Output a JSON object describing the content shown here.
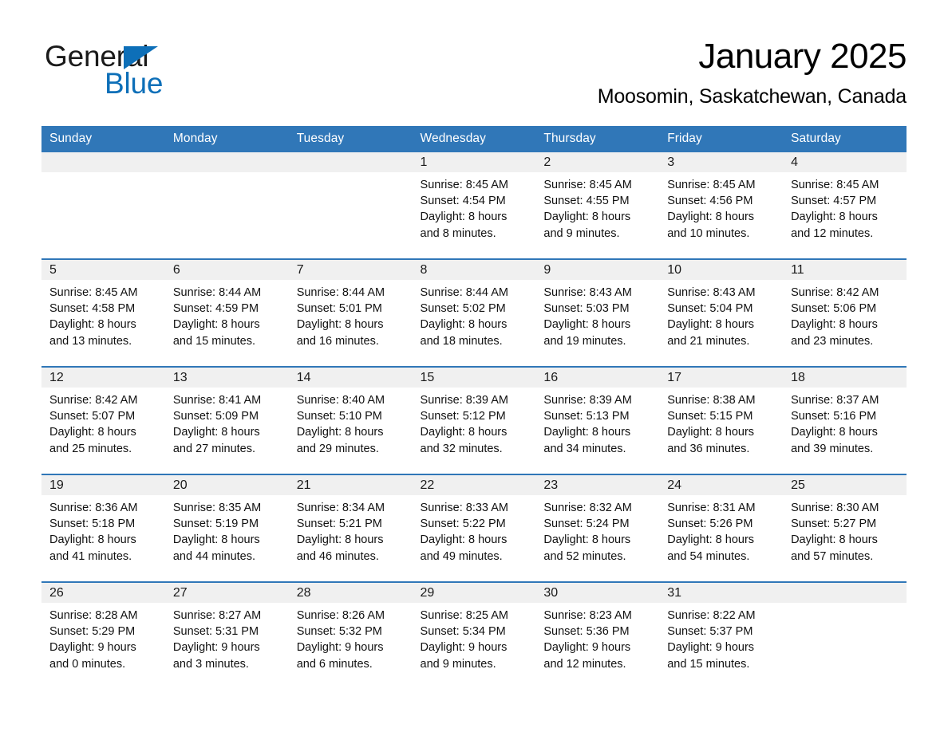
{
  "logo": {
    "word_one": "General",
    "word_two": "Blue",
    "triangle_icon": "triangle-icon",
    "brand_blue": "#0d6fb8"
  },
  "header": {
    "title": "January 2025",
    "location": "Moosomin, Saskatchewan, Canada"
  },
  "theme": {
    "header_blue": "#3077b8",
    "daynum_band": "#f0f0f0",
    "text": "#111111",
    "page_background": "#ffffff"
  },
  "weekday_headers": [
    "Sunday",
    "Monday",
    "Tuesday",
    "Wednesday",
    "Thursday",
    "Friday",
    "Saturday"
  ],
  "weeks": [
    [
      {
        "day": "",
        "info": ""
      },
      {
        "day": "",
        "info": ""
      },
      {
        "day": "",
        "info": ""
      },
      {
        "day": "1",
        "info": "Sunrise: 8:45 AM\nSunset: 4:54 PM\nDaylight: 8 hours\nand 8 minutes."
      },
      {
        "day": "2",
        "info": "Sunrise: 8:45 AM\nSunset: 4:55 PM\nDaylight: 8 hours\nand 9 minutes."
      },
      {
        "day": "3",
        "info": "Sunrise: 8:45 AM\nSunset: 4:56 PM\nDaylight: 8 hours\nand 10 minutes."
      },
      {
        "day": "4",
        "info": "Sunrise: 8:45 AM\nSunset: 4:57 PM\nDaylight: 8 hours\nand 12 minutes."
      }
    ],
    [
      {
        "day": "5",
        "info": "Sunrise: 8:45 AM\nSunset: 4:58 PM\nDaylight: 8 hours\nand 13 minutes."
      },
      {
        "day": "6",
        "info": "Sunrise: 8:44 AM\nSunset: 4:59 PM\nDaylight: 8 hours\nand 15 minutes."
      },
      {
        "day": "7",
        "info": "Sunrise: 8:44 AM\nSunset: 5:01 PM\nDaylight: 8 hours\nand 16 minutes."
      },
      {
        "day": "8",
        "info": "Sunrise: 8:44 AM\nSunset: 5:02 PM\nDaylight: 8 hours\nand 18 minutes."
      },
      {
        "day": "9",
        "info": "Sunrise: 8:43 AM\nSunset: 5:03 PM\nDaylight: 8 hours\nand 19 minutes."
      },
      {
        "day": "10",
        "info": "Sunrise: 8:43 AM\nSunset: 5:04 PM\nDaylight: 8 hours\nand 21 minutes."
      },
      {
        "day": "11",
        "info": "Sunrise: 8:42 AM\nSunset: 5:06 PM\nDaylight: 8 hours\nand 23 minutes."
      }
    ],
    [
      {
        "day": "12",
        "info": "Sunrise: 8:42 AM\nSunset: 5:07 PM\nDaylight: 8 hours\nand 25 minutes."
      },
      {
        "day": "13",
        "info": "Sunrise: 8:41 AM\nSunset: 5:09 PM\nDaylight: 8 hours\nand 27 minutes."
      },
      {
        "day": "14",
        "info": "Sunrise: 8:40 AM\nSunset: 5:10 PM\nDaylight: 8 hours\nand 29 minutes."
      },
      {
        "day": "15",
        "info": "Sunrise: 8:39 AM\nSunset: 5:12 PM\nDaylight: 8 hours\nand 32 minutes."
      },
      {
        "day": "16",
        "info": "Sunrise: 8:39 AM\nSunset: 5:13 PM\nDaylight: 8 hours\nand 34 minutes."
      },
      {
        "day": "17",
        "info": "Sunrise: 8:38 AM\nSunset: 5:15 PM\nDaylight: 8 hours\nand 36 minutes."
      },
      {
        "day": "18",
        "info": "Sunrise: 8:37 AM\nSunset: 5:16 PM\nDaylight: 8 hours\nand 39 minutes."
      }
    ],
    [
      {
        "day": "19",
        "info": "Sunrise: 8:36 AM\nSunset: 5:18 PM\nDaylight: 8 hours\nand 41 minutes."
      },
      {
        "day": "20",
        "info": "Sunrise: 8:35 AM\nSunset: 5:19 PM\nDaylight: 8 hours\nand 44 minutes."
      },
      {
        "day": "21",
        "info": "Sunrise: 8:34 AM\nSunset: 5:21 PM\nDaylight: 8 hours\nand 46 minutes."
      },
      {
        "day": "22",
        "info": "Sunrise: 8:33 AM\nSunset: 5:22 PM\nDaylight: 8 hours\nand 49 minutes."
      },
      {
        "day": "23",
        "info": "Sunrise: 8:32 AM\nSunset: 5:24 PM\nDaylight: 8 hours\nand 52 minutes."
      },
      {
        "day": "24",
        "info": "Sunrise: 8:31 AM\nSunset: 5:26 PM\nDaylight: 8 hours\nand 54 minutes."
      },
      {
        "day": "25",
        "info": "Sunrise: 8:30 AM\nSunset: 5:27 PM\nDaylight: 8 hours\nand 57 minutes."
      }
    ],
    [
      {
        "day": "26",
        "info": "Sunrise: 8:28 AM\nSunset: 5:29 PM\nDaylight: 9 hours\nand 0 minutes."
      },
      {
        "day": "27",
        "info": "Sunrise: 8:27 AM\nSunset: 5:31 PM\nDaylight: 9 hours\nand 3 minutes."
      },
      {
        "day": "28",
        "info": "Sunrise: 8:26 AM\nSunset: 5:32 PM\nDaylight: 9 hours\nand 6 minutes."
      },
      {
        "day": "29",
        "info": "Sunrise: 8:25 AM\nSunset: 5:34 PM\nDaylight: 9 hours\nand 9 minutes."
      },
      {
        "day": "30",
        "info": "Sunrise: 8:23 AM\nSunset: 5:36 PM\nDaylight: 9 hours\nand 12 minutes."
      },
      {
        "day": "31",
        "info": "Sunrise: 8:22 AM\nSunset: 5:37 PM\nDaylight: 9 hours\nand 15 minutes."
      },
      {
        "day": "",
        "info": ""
      }
    ]
  ]
}
